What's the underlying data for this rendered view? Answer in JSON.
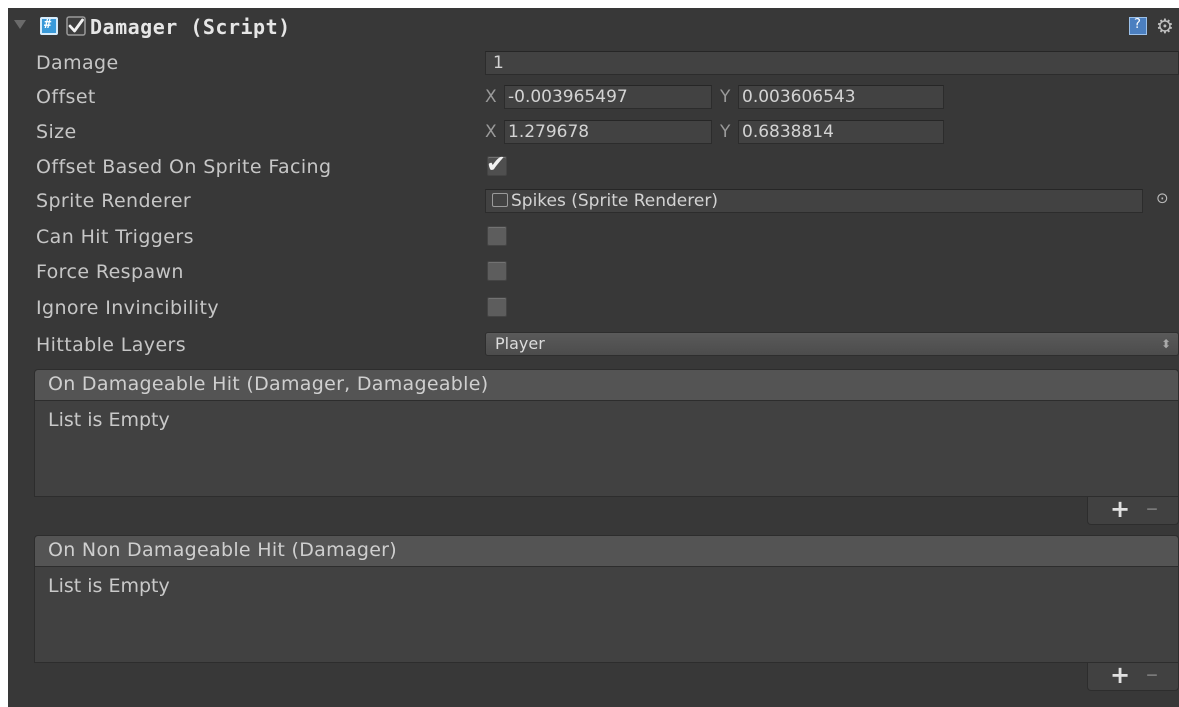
{
  "header": {
    "title": "Damager (Script)",
    "enabled": true,
    "icons": [
      "foldout-arrow-icon",
      "script-icon",
      "help-icon",
      "gear-icon"
    ]
  },
  "fields": {
    "damage": {
      "label": "Damage",
      "value": "1"
    },
    "offset": {
      "label": "Offset",
      "x_axis": "X",
      "x": "-0.003965497",
      "y_axis": "Y",
      "y": "0.003606543"
    },
    "size": {
      "label": "Size",
      "x_axis": "X",
      "x": "1.279678",
      "y_axis": "Y",
      "y": "0.6838814"
    },
    "offset_based_on_sprite_facing": {
      "label": "Offset Based On Sprite Facing",
      "checked": true
    },
    "sprite_renderer": {
      "label": "Sprite Renderer",
      "value": "Spikes (Sprite Renderer)"
    },
    "can_hit_triggers": {
      "label": "Can Hit Triggers",
      "checked": false
    },
    "force_respawn": {
      "label": "Force Respawn",
      "checked": false
    },
    "ignore_invincibility": {
      "label": "Ignore Invincibility",
      "checked": false
    },
    "hittable_layers": {
      "label": "Hittable Layers",
      "value": "Player"
    }
  },
  "events": [
    {
      "title": "On Damageable Hit (Damager, Damageable)",
      "empty_text": "List is Empty",
      "add_label": "+",
      "remove_label": "–"
    },
    {
      "title": "On Non Damageable Hit (Damager)",
      "empty_text": "List is Empty",
      "add_label": "+",
      "remove_label": "–"
    }
  ],
  "glyphs": {
    "check": "✔",
    "gear": "⚙",
    "picker": "⊙",
    "updown": "⬍"
  }
}
